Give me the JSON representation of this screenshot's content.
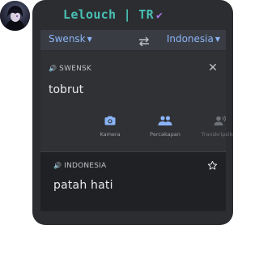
{
  "message": {
    "username": "Lelouch | TR",
    "verified_icon": "check-icon",
    "accent_color": "#49c0b4"
  },
  "translator": {
    "source_language": "Swensk",
    "target_language": "Indonesia",
    "source_label": "SWENSK",
    "input_text": "tobrut",
    "tools": [
      {
        "label": "Kamera",
        "icon": "camera-icon",
        "enabled": true
      },
      {
        "label": "Percakapan",
        "icon": "people-icon",
        "enabled": true
      },
      {
        "label": "Transkripsikan",
        "icon": "transcribe-icon",
        "enabled": false
      }
    ],
    "result_label": "INDONESIA",
    "output_text": "patah hati",
    "link_color": "#8ab4f8"
  }
}
